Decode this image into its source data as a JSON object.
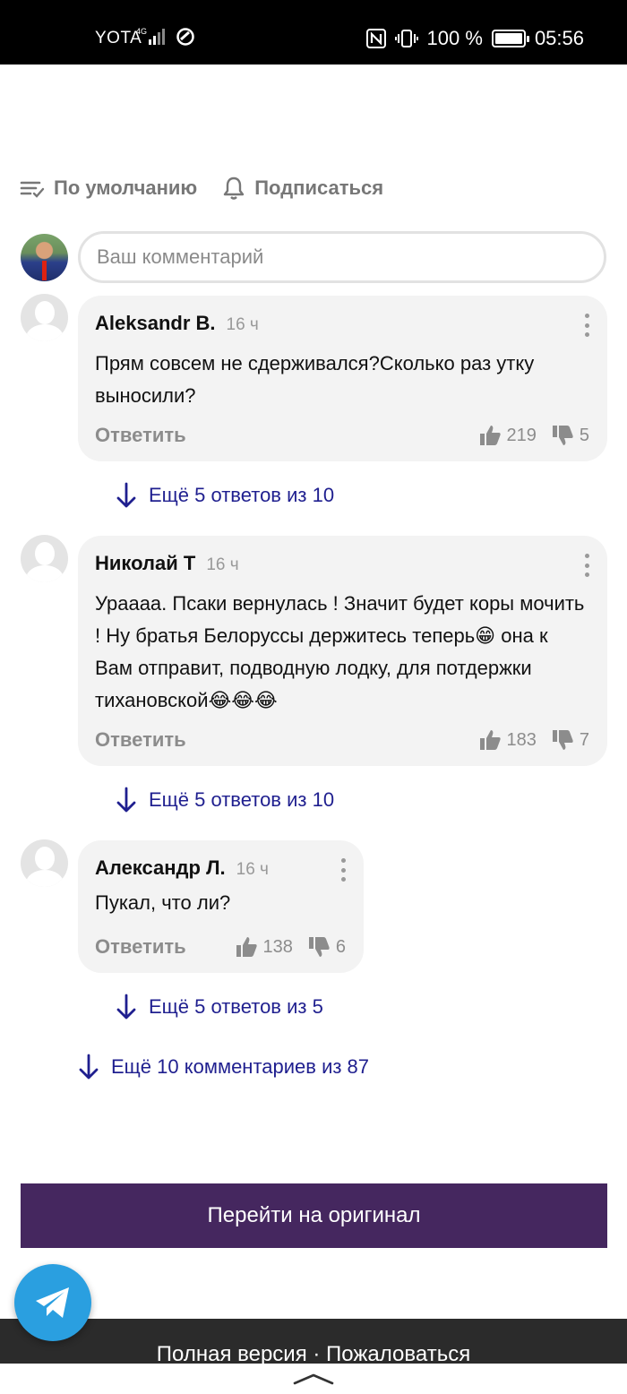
{
  "status_bar": {
    "carrier": "YOTA",
    "network": "4G",
    "battery": "100 %",
    "time": "05:56"
  },
  "toolbar": {
    "sort_label": "По умолчанию",
    "subscribe_label": "Подписаться"
  },
  "comment_input": {
    "placeholder": "Ваш комментарий"
  },
  "comments": [
    {
      "author": "Aleksandr B.",
      "time": "16 ч",
      "text": "Прям совсем не сдерживался?Сколько раз утку выносили?",
      "reply_label": "Ответить",
      "likes": "219",
      "dislikes": "5",
      "more_replies": "Ещё 5 ответов из 10"
    },
    {
      "author": "Николай Т",
      "time": "16 ч",
      "text": "Урaaaa. Псаки вернулась ! Значит будет коры мочить ! Ну братья Белоруссы держитесь теперь😁 она к Вам отправит, подводную лодку, для потдержки тихановской😂😂😂",
      "reply_label": "Ответить",
      "likes": "183",
      "dislikes": "7",
      "more_replies": "Ещё 5 ответов из 10"
    },
    {
      "author": "Александр Л.",
      "time": "16 ч",
      "text": "Пукал, что ли?",
      "reply_label": "Ответить",
      "likes": "138",
      "dislikes": "6",
      "more_replies": "Ещё 5 ответов из 5"
    }
  ],
  "more_comments": "Ещё 10 комментариев из 87",
  "original_button": "Перейти на оригинал",
  "footer": {
    "full_version": "Полная версия",
    "separator": "·",
    "report": "Пожаловаться"
  },
  "colors": {
    "accent_link": "#1f1f8f",
    "button_bg": "#45275f",
    "telegram": "#2a9fe0",
    "bubble_bg": "#f3f3f3"
  }
}
